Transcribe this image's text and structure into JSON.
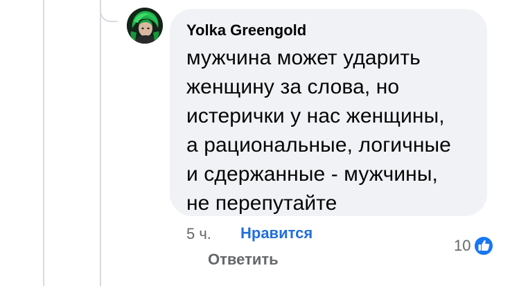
{
  "comment": {
    "author": "Yolka Greengold",
    "text": "мужчина может ударить\nженщину за слова, но\nистерички у нас женщины,\nа рациональные, логичные\nи сдержанные - мужчины,\nне перепутайте",
    "time": "5 ч.",
    "like_label": "Нравится",
    "reply_label": "Ответить",
    "reaction_count": "10",
    "reaction_icon": "thumbs-up-icon"
  },
  "colors": {
    "bubble_bg": "#f0f2f5",
    "link_blue": "#216fdb",
    "meta_gray": "#65676b",
    "like_badge": "#1877f2"
  }
}
